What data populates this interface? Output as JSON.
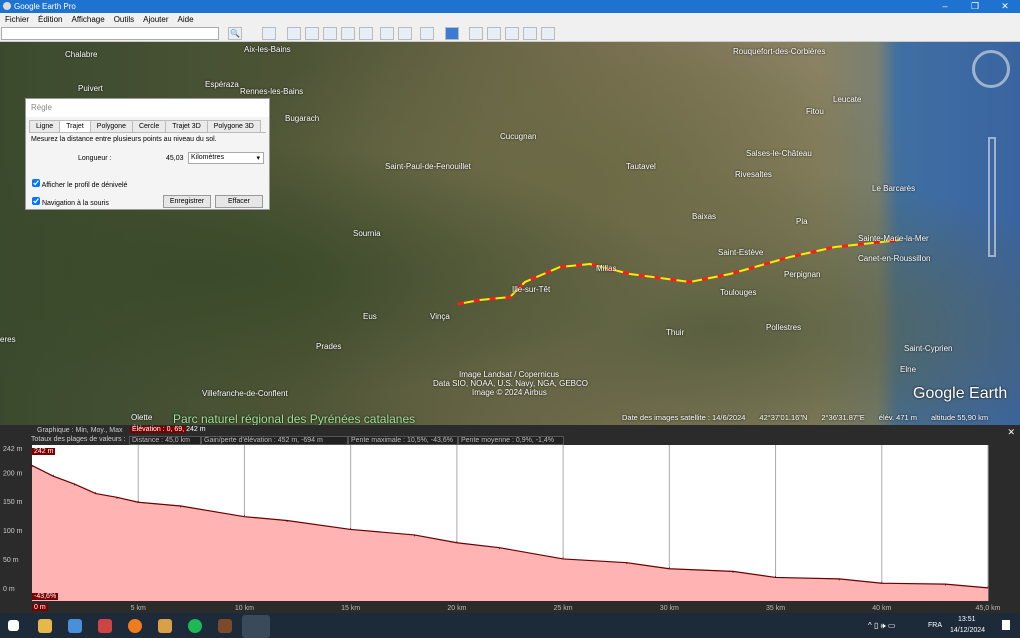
{
  "window": {
    "title": "Google Earth Pro",
    "controls": [
      "–",
      "❐",
      "✕"
    ]
  },
  "menu": [
    "Fichier",
    "Édition",
    "Affichage",
    "Outils",
    "Ajouter",
    "Aide"
  ],
  "search": {
    "value": ""
  },
  "map": {
    "places": [
      "Aix-les-Bains",
      "Chalabre",
      "Puivert",
      "Espéraza",
      "Rennes-les-Bains",
      "Bugarach",
      "Cucugnan",
      "Saint-Paul-de-Fenouillet",
      "Tautavel",
      "Rivesaltes",
      "Salses-le-Château",
      "Leucate",
      "Fitou",
      "Le Barcarès",
      "Baixas",
      "Pia",
      "Saint-Estève",
      "Sainte-Marie-la-Mer",
      "Canet-en-Roussillon",
      "Perpignan",
      "Toulouges",
      "Millas",
      "Ille-sur-Têt",
      "Vinça",
      "Eus",
      "Sournia",
      "Prades",
      "Villefranche-de-Conflent",
      "Olette",
      "Thuir",
      "Pollestres",
      "Saint-Cyprien",
      "Elne",
      "Rouquefort-des-Corbières",
      "eres"
    ],
    "park": "Parc naturel régional des Pyrénées catalanes",
    "attribution": [
      "Image Landsat / Copernicus",
      "Data SIO, NOAA, U.S. Navy, NGA, GEBCO",
      "Image © 2024 Airbus"
    ],
    "logo": "Google Earth",
    "status": {
      "date": "Date des images satellite : 14/6/2024",
      "lat": "42°37'01.16\"N",
      "lon": "2°36'31.87\"E",
      "elev": "élév.  471 m",
      "alt": "altitude  55,90 km"
    }
  },
  "ruler": {
    "title": "Règle",
    "tabs": [
      "Ligne",
      "Trajet",
      "Polygone",
      "Cercle",
      "Trajet 3D",
      "Polygone 3D"
    ],
    "active_tab": 1,
    "desc": "Mesurez la distance entre plusieurs points au niveau du sol.",
    "length_label": "Longueur :",
    "length_value": "45,03",
    "unit": "Kilomètres",
    "show_profile": "Afficher le profil de dénivelé",
    "mouse_nav": "Navigation à la souris",
    "save": "Enregistrer",
    "clear": "Effacer"
  },
  "profile": {
    "graph_label": "Graphique : Min, Moy., Max",
    "elevation": "Élévation : 0, 69, 242 m",
    "totals_label": "Totaux des plages de valeurs :",
    "distance": "Distance : 45,0 km",
    "gain": "Gain/perte d'élévation : 452 m, -694 m",
    "max_slope": "Pente maximale : 10,5%, -43,6%",
    "avg_slope": "Pente moyenne : 0,9%, -1,4%",
    "max_tag": "242 m",
    "min_slope_tag": "-43,6%",
    "start_tag": "0 m",
    "close": "✕"
  },
  "chart_data": {
    "type": "area",
    "x": [
      0,
      1,
      2,
      3,
      4,
      5,
      7,
      10,
      12,
      15,
      18,
      20,
      22,
      25,
      28,
      30,
      33,
      35,
      38,
      40,
      43,
      45
    ],
    "values": [
      210,
      195,
      178,
      165,
      155,
      150,
      140,
      125,
      115,
      103,
      90,
      80,
      68,
      52,
      42,
      35,
      27,
      20,
      14,
      10,
      5,
      2
    ],
    "xlabel": "",
    "ylabel": "",
    "xlim": [
      0,
      45
    ],
    "ylim": [
      0,
      242
    ],
    "yticks": [
      "242 m",
      "200 m",
      "150 m",
      "100 m",
      "50 m",
      "0 m"
    ],
    "ytick_values": [
      242,
      200,
      150,
      100,
      50,
      0
    ],
    "xticks": [
      "5 km",
      "10 km",
      "15 km",
      "20 km",
      "25 km",
      "30 km",
      "35 km",
      "40 km",
      "45,0 km"
    ],
    "xtick_values": [
      5,
      10,
      15,
      20,
      25,
      30,
      35,
      40,
      45
    ]
  },
  "taskbar": {
    "lang": "FRA",
    "time": "13:51",
    "date": "14/12/2024"
  }
}
